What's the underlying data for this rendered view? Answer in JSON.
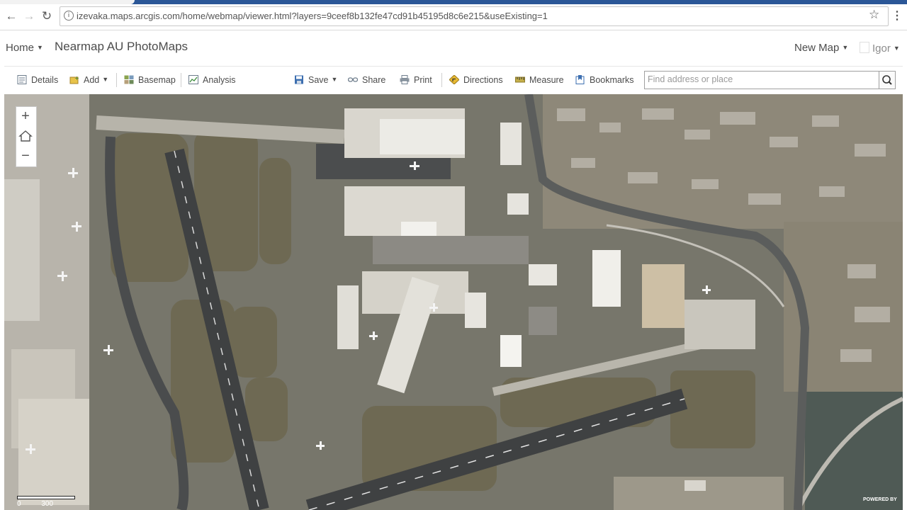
{
  "browser": {
    "url": "izevaka.maps.arcgis.com/home/webmap/viewer.html?layers=9ceef8b132fe47cd91b45195d8c6e215&useExisting=1",
    "back_icon": "arrow-left",
    "forward_icon": "arrow-right",
    "reload_icon": "reload",
    "info_icon": "info",
    "star_icon": "star",
    "menu_icon": "kebab"
  },
  "header": {
    "home_label": "Home",
    "map_title": "Nearmap AU PhotoMaps",
    "new_map_label": "New Map",
    "user_label": "Igor"
  },
  "toolbar": {
    "details": "Details",
    "add": "Add",
    "basemap": "Basemap",
    "analysis": "Analysis",
    "save": "Save",
    "share": "Share",
    "print": "Print",
    "directions": "Directions",
    "measure": "Measure",
    "bookmarks": "Bookmarks",
    "search_placeholder": "Find address or place"
  },
  "map": {
    "zoom_in": "+",
    "zoom_out": "−",
    "scale_label_start": "0",
    "scale_label_end": "300",
    "attribution": "POWERED BY",
    "colors": {
      "asphalt": "#4b4d4e",
      "grass": "#6b6652",
      "concrete": "#b9b5ac"
    }
  }
}
